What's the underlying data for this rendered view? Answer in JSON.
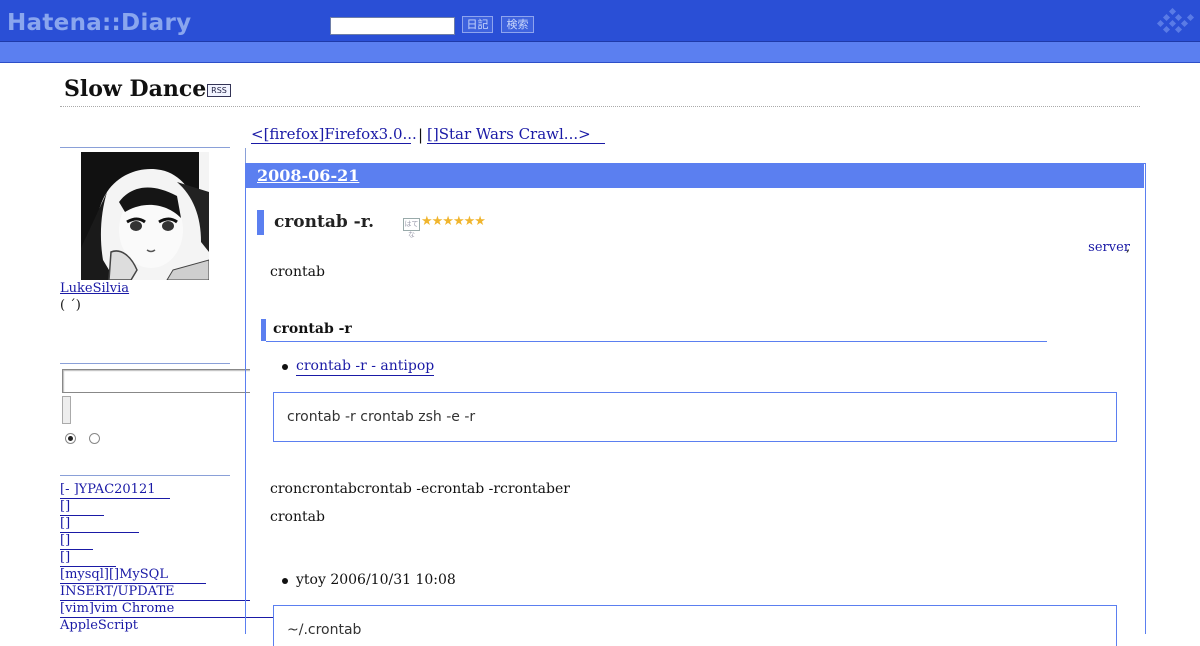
{
  "header": {
    "logo": "Hatena::Diary",
    "search_placeholder": "",
    "diary_button": "日記",
    "search_button": "検索"
  },
  "blog": {
    "title": "Slow Dance",
    "rss": "RSS"
  },
  "sidebar": {
    "username": "LukeSilvia",
    "user_note": "( ´)",
    "search_input_value": "",
    "recent_links": [
      "[- ]YPAC20121",
      "[]",
      "[]",
      "[]",
      "[]",
      "[mysql][]MySQL",
      "INSERT/UPDATE",
      "[vim]vim Chrome",
      "AppleScript"
    ]
  },
  "pager": {
    "prev": "<[firefox]Firefox3.0...",
    "separator": "|",
    "next": "[]Star Wars Crawl...>"
  },
  "entry": {
    "date": "2008-06-21",
    "section_title": "crontab -r.",
    "hatena_tag": "はてな",
    "stars": "★★★★★★",
    "category": "server",
    "category_comma": ",",
    "intro": "crontab",
    "subsection_title": "crontab -r",
    "link_item": "crontab -r  - antipop",
    "code_1": "crontab -r crontab  zsh  -e  -r",
    "para_1": "croncrontabcrontab -ecrontab -rcrontaber",
    "para_2": "crontab",
    "comment_item": "ytoy 2006/10/31 10:08",
    "code_2": "~/.crontab"
  },
  "colors": {
    "header_blue": "#2a4fd6",
    "accent_blue": "#5b7ff0",
    "link": "#1a1aa6",
    "star": "#f0b52e"
  },
  "icons": [
    "hatena-diamond-logo-icon",
    "rss-icon",
    "hatena-tag-icon",
    "star-icon"
  ]
}
